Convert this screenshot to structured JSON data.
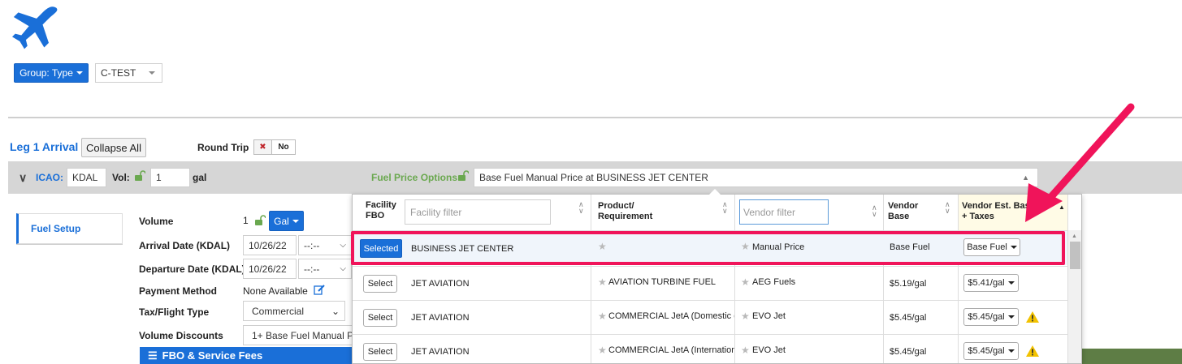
{
  "top": {
    "group_button": "Group: Type",
    "aircraft_select": "C-TEST"
  },
  "leg": {
    "title": "Leg 1 Arrival",
    "collapse_all": "Collapse All",
    "round_trip_label": "Round Trip",
    "round_trip_x": "✖",
    "round_trip_value": "No",
    "icao_label": "ICAO:",
    "icao_value": "KDAL",
    "vol_label": "Vol:",
    "vol_value": "1",
    "vol_unit": "gal",
    "fuel_price_options_label": "Fuel Price Options:",
    "fuel_price_options_value": "Base Fuel Manual Price at BUSINESS JET CENTER"
  },
  "left": {
    "fuel_setup_tab": "Fuel Setup",
    "volume_label": "Volume",
    "volume_value": "1",
    "volume_unit": "Gal",
    "arrival_label": "Arrival Date (KDAL)",
    "arrival_date": "10/26/22",
    "arrival_time": "--:--",
    "departure_label": "Departure Date (KDAL)",
    "departure_date": "10/26/22",
    "departure_time": "--:--",
    "payment_label": "Payment Method",
    "payment_value": "None Available",
    "tax_label": "Tax/Flight Type",
    "tax_value": "Commercial",
    "volume_discounts_label": "Volume Discounts",
    "volume_discounts_value": "1+ Base Fuel Manual Pr",
    "fbo_band": "FBO & Service Fees"
  },
  "table": {
    "col_facility": "Facility FBO",
    "facility_filter_placeholder": "Facility filter",
    "col_product": "Product/ Requirement",
    "vendor_filter_placeholder": "Vendor filter",
    "col_vendor_base": "Vendor Base",
    "col_vendor_est": "Vendor Est. Base + Taxes",
    "rows": [
      {
        "action": "Selected",
        "facility": "BUSINESS JET CENTER",
        "product": "",
        "vendor": "Manual Price",
        "base": "Base Fuel",
        "est": "Base Fuel"
      },
      {
        "action": "Select",
        "facility": "JET AVIATION",
        "product": "AVIATION TURBINE FUEL",
        "vendor": "AEG Fuels",
        "base": "$5.19/gal",
        "est": "$5.41/gal"
      },
      {
        "action": "Select",
        "facility": "JET AVIATION",
        "product": "COMMERCIAL JetA (Domestic c",
        "vendor": "EVO Jet",
        "base": "$5.45/gal",
        "est": "$5.45/gal"
      },
      {
        "action": "Select",
        "facility": "JET AVIATION",
        "product": "COMMERCIAL JetA (Internation",
        "vendor": "EVO Jet",
        "base": "$5.45/gal",
        "est": "$5.45/gal"
      }
    ]
  },
  "colors": {
    "accent": "#1a6fd8",
    "highlight": "#f0145a",
    "warning": "#f2c200",
    "lock": "#6aa84f"
  }
}
